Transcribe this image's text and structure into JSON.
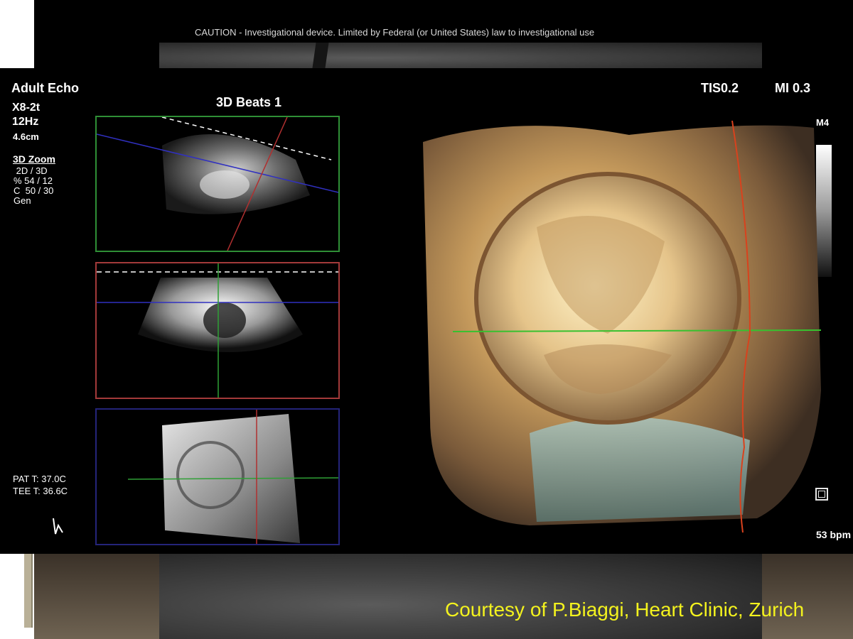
{
  "header": {
    "caution": "CAUTION - Investigational device. Limited by Federal (or United States) law to investigational use"
  },
  "echo": {
    "mode": "Adult Echo",
    "probe": "X8-2t",
    "frequency": "12Hz",
    "depth": "4.6cm",
    "zoom_title": "3D Zoom",
    "zoom_params": [
      " 2D / 3D",
      "% 54 / 12",
      "C  50 / 30",
      "Gen"
    ],
    "pat_temp": "PAT T: 37.0C",
    "tee_temp": "TEE T: 36.6C",
    "beats_title": "3D Beats 1",
    "tis": "TIS0.2",
    "mi": "MI 0.3",
    "map": "M4",
    "heart_rate": "53 bpm",
    "icons": [
      "ecg-trigger-icon",
      "fullscreen-icon"
    ],
    "pane_colors": {
      "axial": "#2f8f36",
      "sagittal": "#a33a3a",
      "coronal": "#24247a"
    }
  },
  "footer": {
    "courtesy": "Courtesy of P.Biaggi, Heart Clinic, Zurich",
    "courtesy_color": "#f3f21e"
  }
}
